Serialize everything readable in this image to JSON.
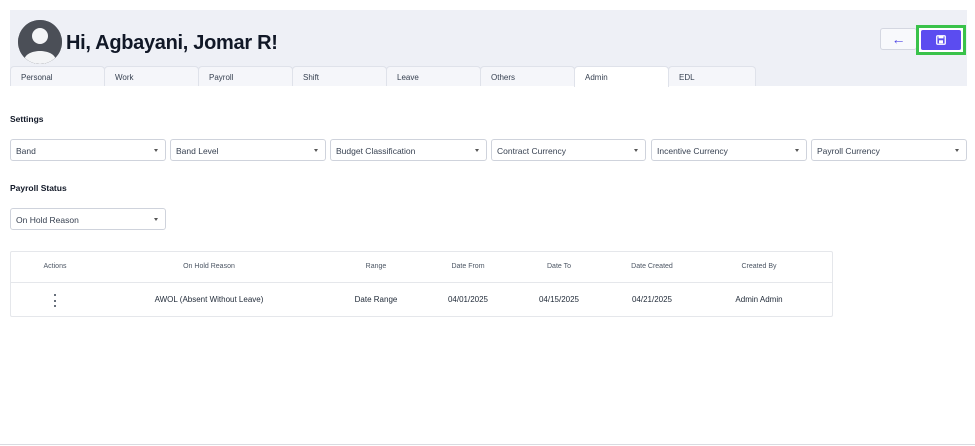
{
  "header": {
    "greeting": "Hi, Agbayani, Jomar R!",
    "back_icon": "←",
    "avatar_icon": "person-silhouette-icon",
    "save_icon": "floppy-disk-icon",
    "accent_color": "#5b4cf0",
    "highlight_color": "#39c24a"
  },
  "tabs": [
    {
      "label": "Personal"
    },
    {
      "label": "Work"
    },
    {
      "label": "Payroll"
    },
    {
      "label": "Shift"
    },
    {
      "label": "Leave"
    },
    {
      "label": "Others"
    },
    {
      "label": "Admin",
      "active": true
    },
    {
      "label": "EDL"
    }
  ],
  "settings": {
    "title": "Settings",
    "fields": [
      {
        "placeholder": "Band"
      },
      {
        "placeholder": "Band Level"
      },
      {
        "placeholder": "Budget Classification"
      },
      {
        "placeholder": "Contract Currency"
      },
      {
        "placeholder": "Incentive Currency"
      },
      {
        "placeholder": "Payroll Currency"
      }
    ]
  },
  "payroll_status": {
    "title": "Payroll Status",
    "on_hold_reason_placeholder": "On Hold Reason"
  },
  "table": {
    "columns": [
      "Actions",
      "On Hold Reason",
      "Range",
      "Date From",
      "Date To",
      "Date Created",
      "Created By"
    ],
    "rows": [
      {
        "on_hold_reason": "AWOL (Absent Without Leave)",
        "range": "Date Range",
        "date_from": "04/01/2025",
        "date_to": "04/15/2025",
        "date_created": "04/21/2025",
        "created_by": "Admin Admin"
      }
    ]
  }
}
